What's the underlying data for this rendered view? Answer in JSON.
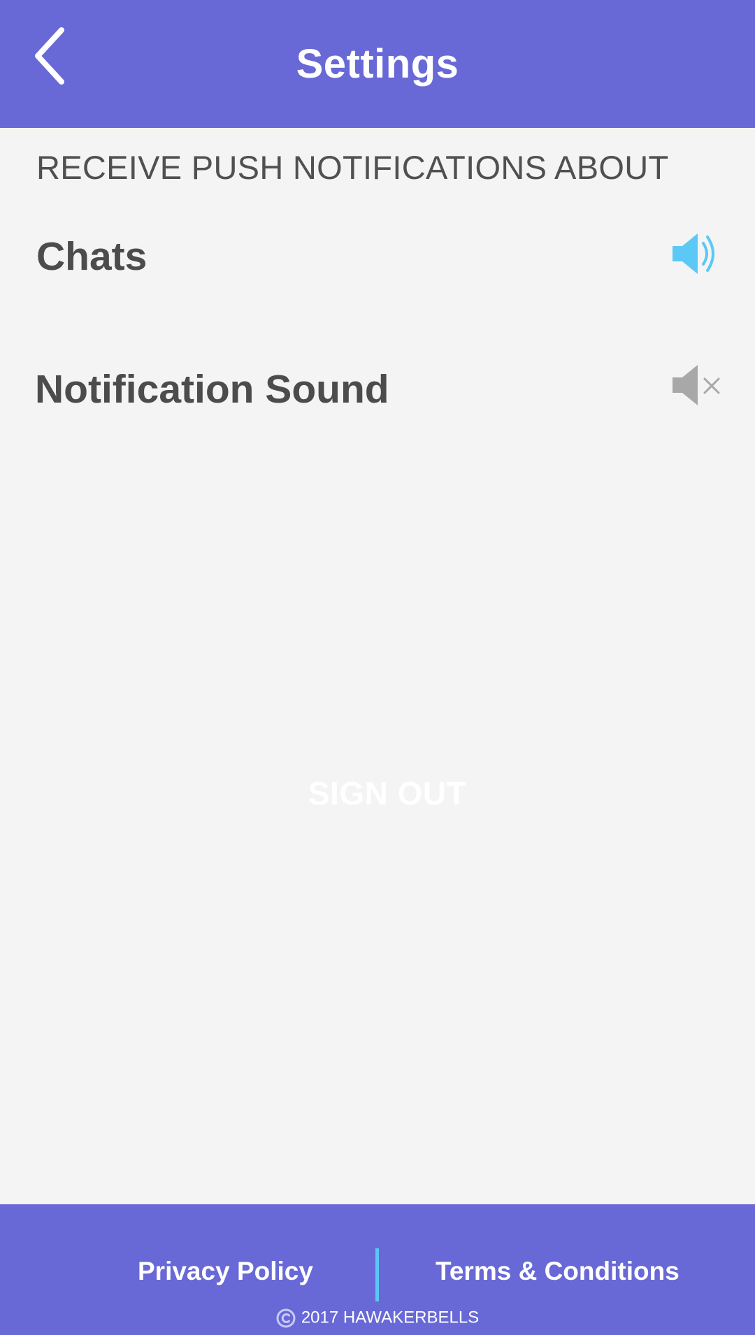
{
  "header": {
    "title": "Settings",
    "back_icon": "chevron-left-icon"
  },
  "section": {
    "label": "RECEIVE PUSH NOTIFICATIONS ABOUT"
  },
  "settings": [
    {
      "label": "Chats",
      "icon": "volume-on-icon",
      "state": "on",
      "color": "#5bc8f5"
    },
    {
      "label": "Notification Sound",
      "icon": "volume-mute-icon",
      "state": "off",
      "color": "#a8a8a8"
    }
  ],
  "actions": {
    "signout_label": "SIGN OUT"
  },
  "footer": {
    "privacy_label": "Privacy Policy",
    "terms_label": "Terms & Conditions",
    "copyright_text": "2017 HAWAKERBELLS",
    "copyright_icon": "copyright-icon"
  },
  "colors": {
    "brand": "#6869d6",
    "accent": "#5bc8f5",
    "background": "#f4f4f4",
    "text_dark": "#4c4c4c",
    "muted_icon": "#a8a8a8"
  }
}
